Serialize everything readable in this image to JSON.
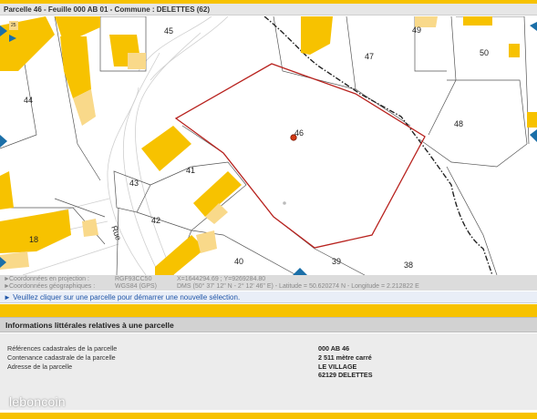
{
  "header": {
    "title": "Parcelle 46 - Feuille 000 AB 01 - Commune : DELETTES (62)"
  },
  "map": {
    "parcel_labels": [
      "45",
      "44",
      "49",
      "47",
      "50",
      "46",
      "48",
      "43",
      "41",
      "42",
      "18",
      "40",
      "39",
      "38",
      "25"
    ],
    "street_label": "Rue",
    "faint_text": "",
    "colors": {
      "building": "#f7c200",
      "building_light": "#f9d98a",
      "selected_parcel": "#b8221e",
      "road": "#cfcfcf",
      "triangle": "#1b6fa8"
    }
  },
  "coordinates": {
    "projection_label": "Coordonnées en projection :",
    "projection_system": "RGF93CC50",
    "projection_values": "X=1644294.69 ; Y=9269284.80",
    "geo_label": "Coordonnées géographiques :",
    "geo_system": "WGS84 (GPS)",
    "geo_values": "DMS (50° 37' 12\" N - 2° 12' 46\" E) - Latitude = 50.620274 N - Longitude = 2.212822 E"
  },
  "hint": "Veuillez cliquer sur une parcelle pour démarrer une nouvelle sélection.",
  "info": {
    "title": "Informations littérales relatives à une parcelle",
    "rows": [
      {
        "label": "Références cadastrales de la parcelle",
        "value": "000 AB 46"
      },
      {
        "label": "Contenance cadastrale de la parcelle",
        "value": "2 511 mètre carré"
      },
      {
        "label": "Adresse de la parcelle",
        "value": "LE VILLAGE"
      },
      {
        "label": "",
        "value": "62129 DELETTES"
      }
    ]
  },
  "watermark": "leboncoin"
}
